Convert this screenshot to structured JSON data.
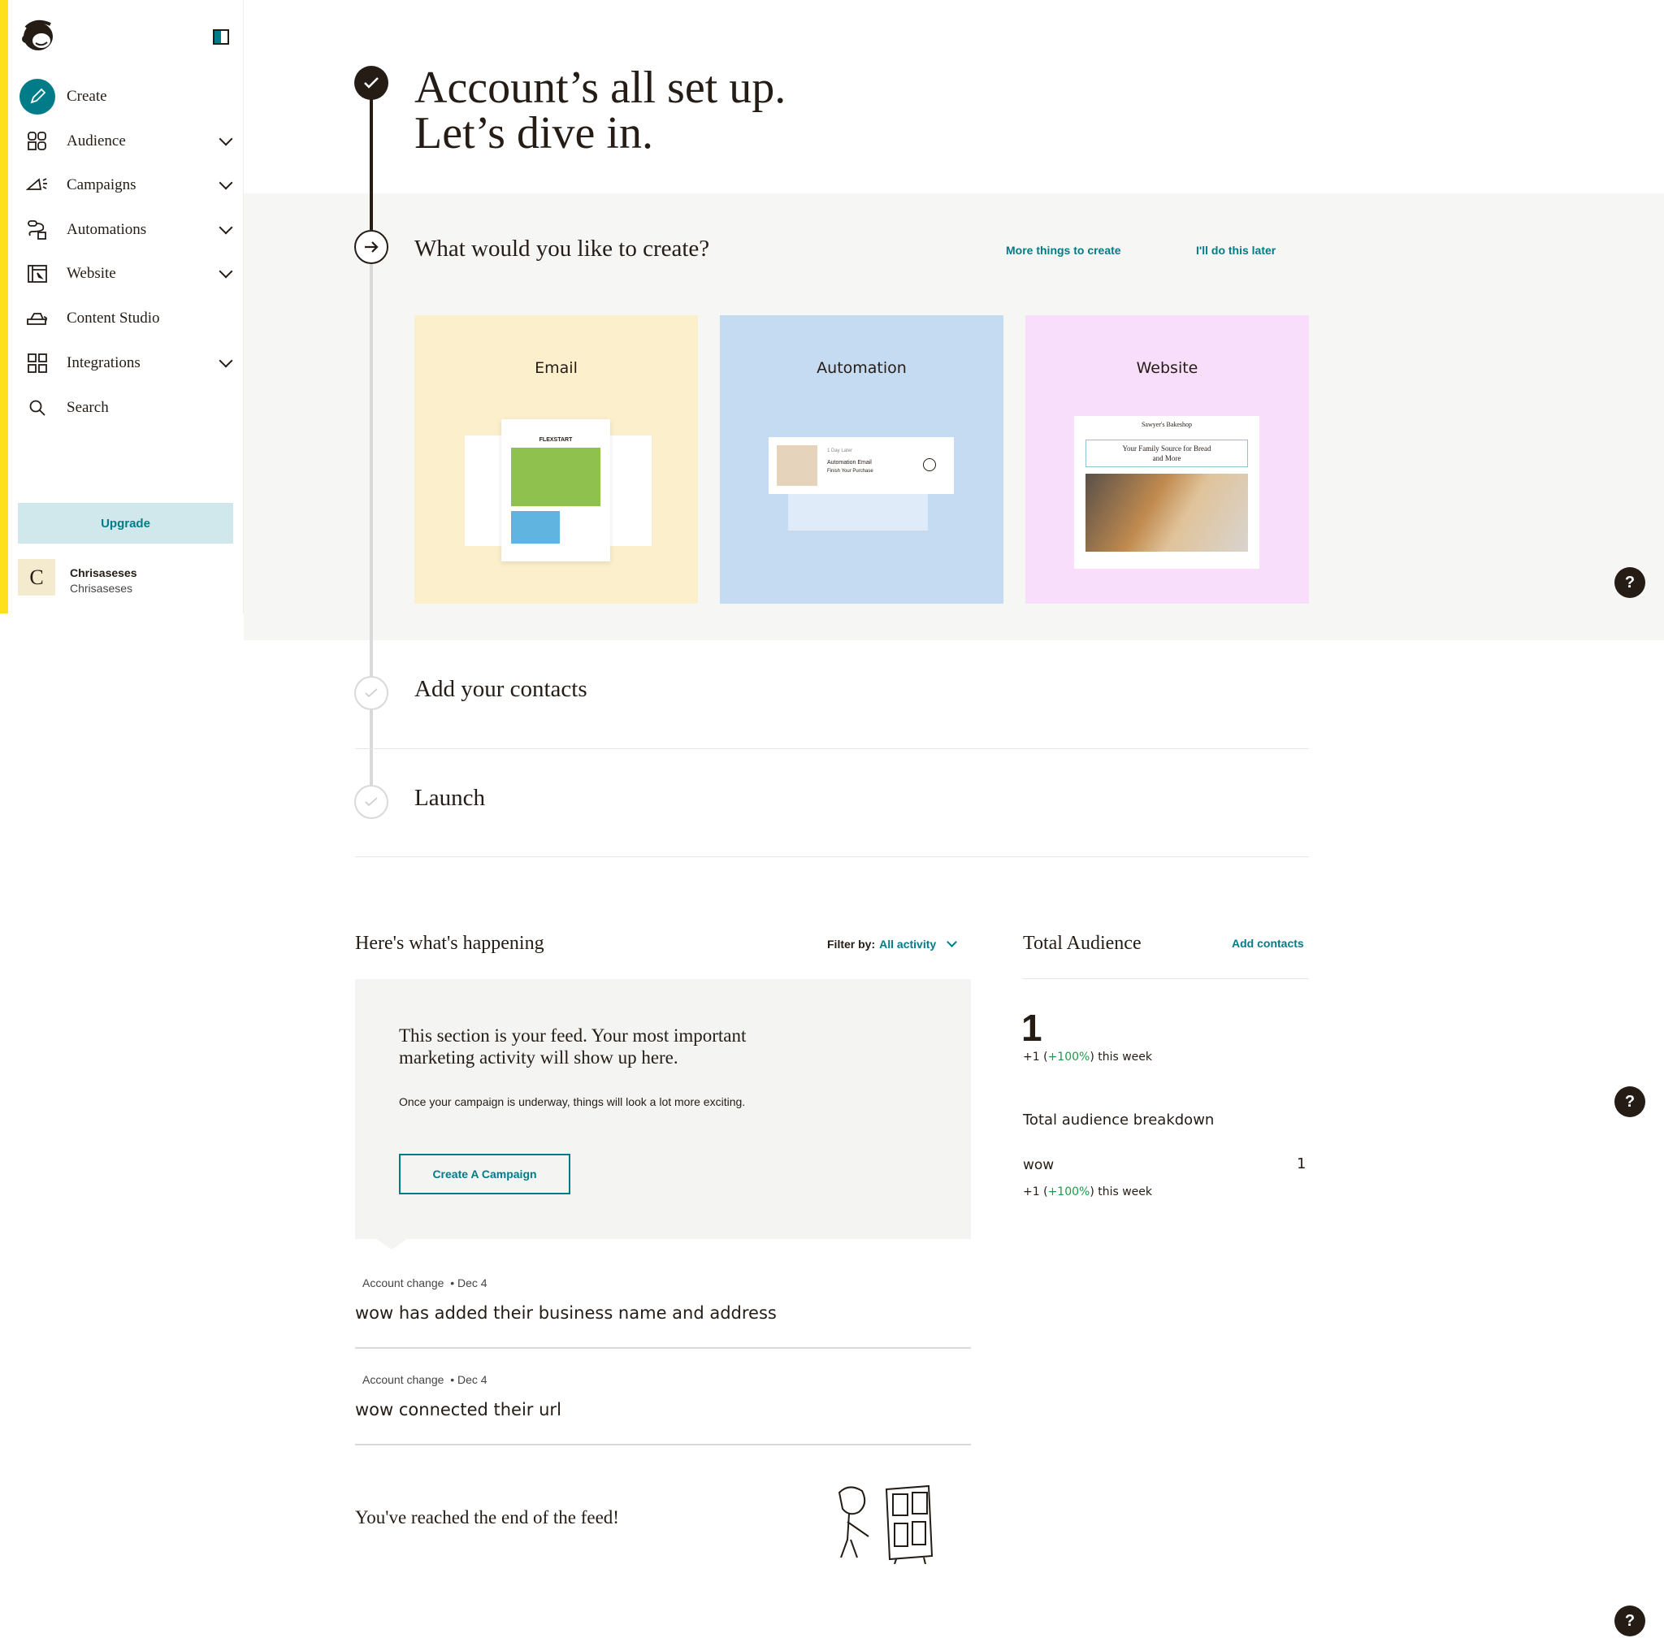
{
  "sidebar": {
    "items": [
      {
        "label": "Create",
        "icon": "pencil-icon"
      },
      {
        "label": "Audience",
        "icon": "audience-icon",
        "expandable": true
      },
      {
        "label": "Campaigns",
        "icon": "megaphone-icon",
        "expandable": true
      },
      {
        "label": "Automations",
        "icon": "automation-icon",
        "expandable": true
      },
      {
        "label": "Website",
        "icon": "website-icon",
        "expandable": true
      },
      {
        "label": "Content Studio",
        "icon": "content-studio-icon"
      },
      {
        "label": "Integrations",
        "icon": "grid-icon",
        "expandable": true
      },
      {
        "label": "Search",
        "icon": "search-icon"
      }
    ],
    "upgrade_label": "Upgrade",
    "profile": {
      "initial": "C",
      "name": "Chrisaseses",
      "account": "Chrisaseses"
    }
  },
  "colors": {
    "accent": "#007c89",
    "brand_yellow": "#ffe01b",
    "positive": "#20994b"
  },
  "hero": {
    "line1": "Account’s all set up.",
    "line2": "Let’s dive in."
  },
  "create_step": {
    "title": "What would you like to create?",
    "more_link": "More things to create",
    "later_link": "I'll do this later",
    "cards": [
      {
        "label": "Email",
        "bg": "#fcefcc",
        "brand_text": "FLEXSTART"
      },
      {
        "label": "Automation",
        "bg": "#c5dbf2",
        "delay": "1 Day Later",
        "email_title": "Automation Email",
        "email_sub": "Finish Your Purchase"
      },
      {
        "label": "Website",
        "bg": "#f8defa",
        "site_name": "Sawyer's Bakeshop",
        "headline": "Your Family Source for Bread and More"
      }
    ]
  },
  "steps": [
    {
      "title": "Add your contacts"
    },
    {
      "title": "Launch"
    }
  ],
  "feed": {
    "title": "Here's what's happening",
    "filter_label": "Filter by:",
    "filter_value": "All activity",
    "intro_heading": "This section is your feed. Your most important marketing activity will show up here.",
    "intro_body": "Once your campaign is underway, things will look a lot more exciting.",
    "cta": "Create A Campaign",
    "items": [
      {
        "type": "Account change",
        "date": "• Dec 4",
        "text": "wow has added their business name and address"
      },
      {
        "type": "Account change",
        "date": "• Dec 4",
        "text": "wow connected their url"
      }
    ],
    "end_text": "You've reached the end of the feed!"
  },
  "audience": {
    "title": "Total Audience",
    "add_link": "Add contacts",
    "total": "1",
    "change_prefix": "+1 (",
    "change_pct": "+100%",
    "change_suffix": ") this week",
    "breakdown_title": "Total audience breakdown",
    "breakdown": [
      {
        "name": "wow",
        "count": "1",
        "change_prefix": "+1 (",
        "change_pct": "+100%",
        "change_suffix": ") this week"
      }
    ]
  },
  "help_label": "?"
}
